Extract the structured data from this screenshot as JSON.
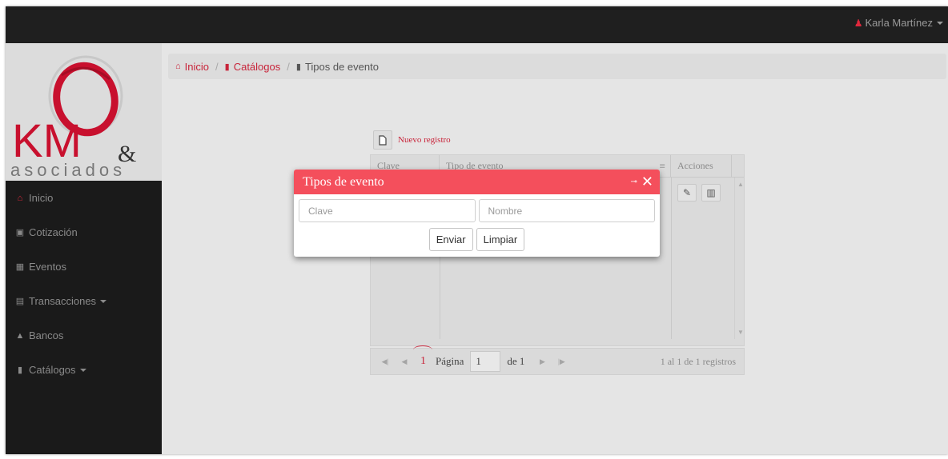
{
  "header": {
    "user_name": "Karla Martínez",
    "user_icon": "user-icon"
  },
  "logo": {
    "letters": "KM",
    "ampersand": "&",
    "subtitle": "asociados",
    "accent_color": "#c8102e"
  },
  "sidebar": {
    "items": [
      {
        "label": "Inicio",
        "icon": "home-icon"
      },
      {
        "label": "Cotización",
        "icon": "cart-icon"
      },
      {
        "label": "Eventos",
        "icon": "calendar-icon"
      },
      {
        "label": "Transacciones",
        "icon": "money-icon"
      },
      {
        "label": "Bancos",
        "icon": "bank-icon"
      },
      {
        "label": "Catálogos",
        "icon": "book-icon"
      }
    ]
  },
  "breadcrumb": {
    "home": "Inicio",
    "catalogs": "Catálogos",
    "current": "Tipos de evento"
  },
  "grid": {
    "new_label": "Nuevo registro",
    "columns": [
      "Clave",
      "Tipo de evento",
      "Acciones"
    ],
    "pager": {
      "current_page_marker": "1",
      "page_label": "Página",
      "page_value": "1",
      "of_label": "de 1",
      "records": "1 al 1 de 1 registros"
    }
  },
  "modal": {
    "title": "Tipos de evento",
    "clave_placeholder": "Clave",
    "nombre_placeholder": "Nombre",
    "submit_label": "Enviar",
    "clear_label": "Limpiar"
  },
  "colors": {
    "accent": "#c8243a",
    "modal_header": "#f44f5c",
    "topbar": "#1f1f1f"
  }
}
